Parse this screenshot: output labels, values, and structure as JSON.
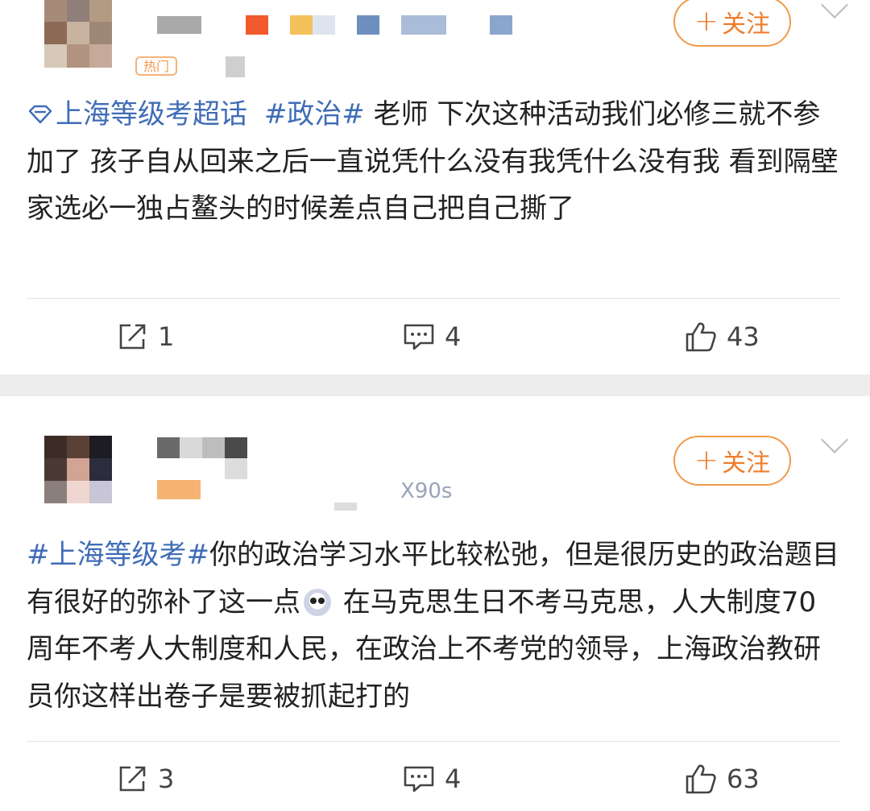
{
  "posts": [
    {
      "follow_label": "关注",
      "hot_badge": "热门",
      "topic_label": "上海等级考超话",
      "hashtag": "#政治#",
      "text": " 老师 下次这种活动我们必修三就不参加了 孩子自从回来之后一直说凭什么没有我凭什么没有我 看到隔壁家选必一独占鳌头的时候差点自己把自己撕了",
      "repost_count": "1",
      "comment_count": "4",
      "like_count": "43"
    },
    {
      "follow_label": "关注",
      "device": "X90s",
      "hashtag": "#上海等级考#",
      "text_before_emoji": "你的政治学习水平比较松弛，但是很历史的政治题目有很好的弥补了这一点",
      "text_after_emoji": " 在马克思生日不考马克思，人大制度70周年不考人大制度和人民，在政治上不考党的领导，上海政治教研员你这样出卷子是要被抓起打的",
      "repost_count": "3",
      "comment_count": "4",
      "like_count": "63"
    }
  ],
  "colors": {
    "topic_blue": "#3f6cb6",
    "follow_orange": "#ee7d2c",
    "separator": "#ededed"
  },
  "icons": [
    "diamond-icon",
    "repost-icon",
    "comment-icon",
    "like-icon",
    "chevron-down-icon",
    "plus-icon",
    "emoji-icon"
  ]
}
